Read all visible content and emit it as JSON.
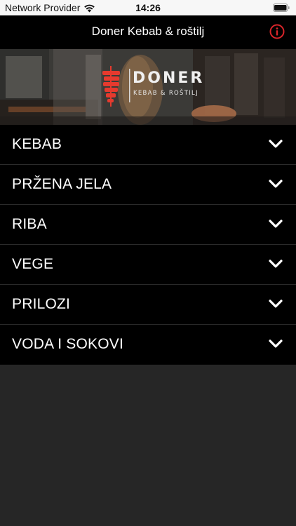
{
  "status_bar": {
    "carrier": "Network Provider",
    "time": "14:26"
  },
  "nav": {
    "title": "Doner Kebab & roštilj",
    "info_icon": "info-icon",
    "accent_color": "#d9252a"
  },
  "banner": {
    "logo_name": "DONER",
    "logo_tagline": "KEBAB & ROŠTILJ"
  },
  "menu": {
    "items": [
      {
        "label": "KEBAB"
      },
      {
        "label": "PRŽENA JELA"
      },
      {
        "label": "RIBA"
      },
      {
        "label": "VEGE"
      },
      {
        "label": "PRILOZI"
      },
      {
        "label": "VODA I SOKOVI"
      }
    ],
    "chevron_icon": "chevron-down-icon"
  }
}
